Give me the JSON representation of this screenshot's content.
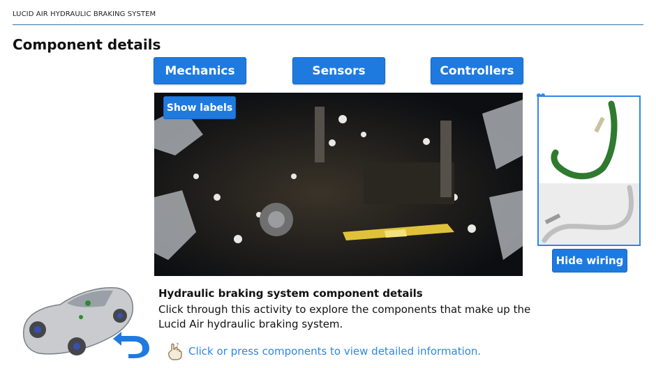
{
  "course": {
    "title": "LUCID AIR HYDRAULIC BRAKING SYSTEM"
  },
  "page": {
    "title": "Component details"
  },
  "categories": [
    {
      "label": "Mechanics"
    },
    {
      "label": "Sensors"
    },
    {
      "label": "Controllers"
    }
  ],
  "scene": {
    "show_labels": "Show labels"
  },
  "wiring": {
    "hide_label": "Hide wiring"
  },
  "info": {
    "heading": "Hydraulic braking system component details",
    "body": "Click through this activity to explore the components that make up the Lucid Air hydraulic braking system."
  },
  "hint": {
    "text": "Click or press components to view detailed information.",
    "icon": "hand-pointer-icon"
  },
  "navigation": {
    "icon": "back-arrow-icon"
  },
  "colors": {
    "accent": "#1f7ae0",
    "link": "#2f86e8",
    "rule": "#2f73a8",
    "wiring_green": "#2f8a2f"
  }
}
